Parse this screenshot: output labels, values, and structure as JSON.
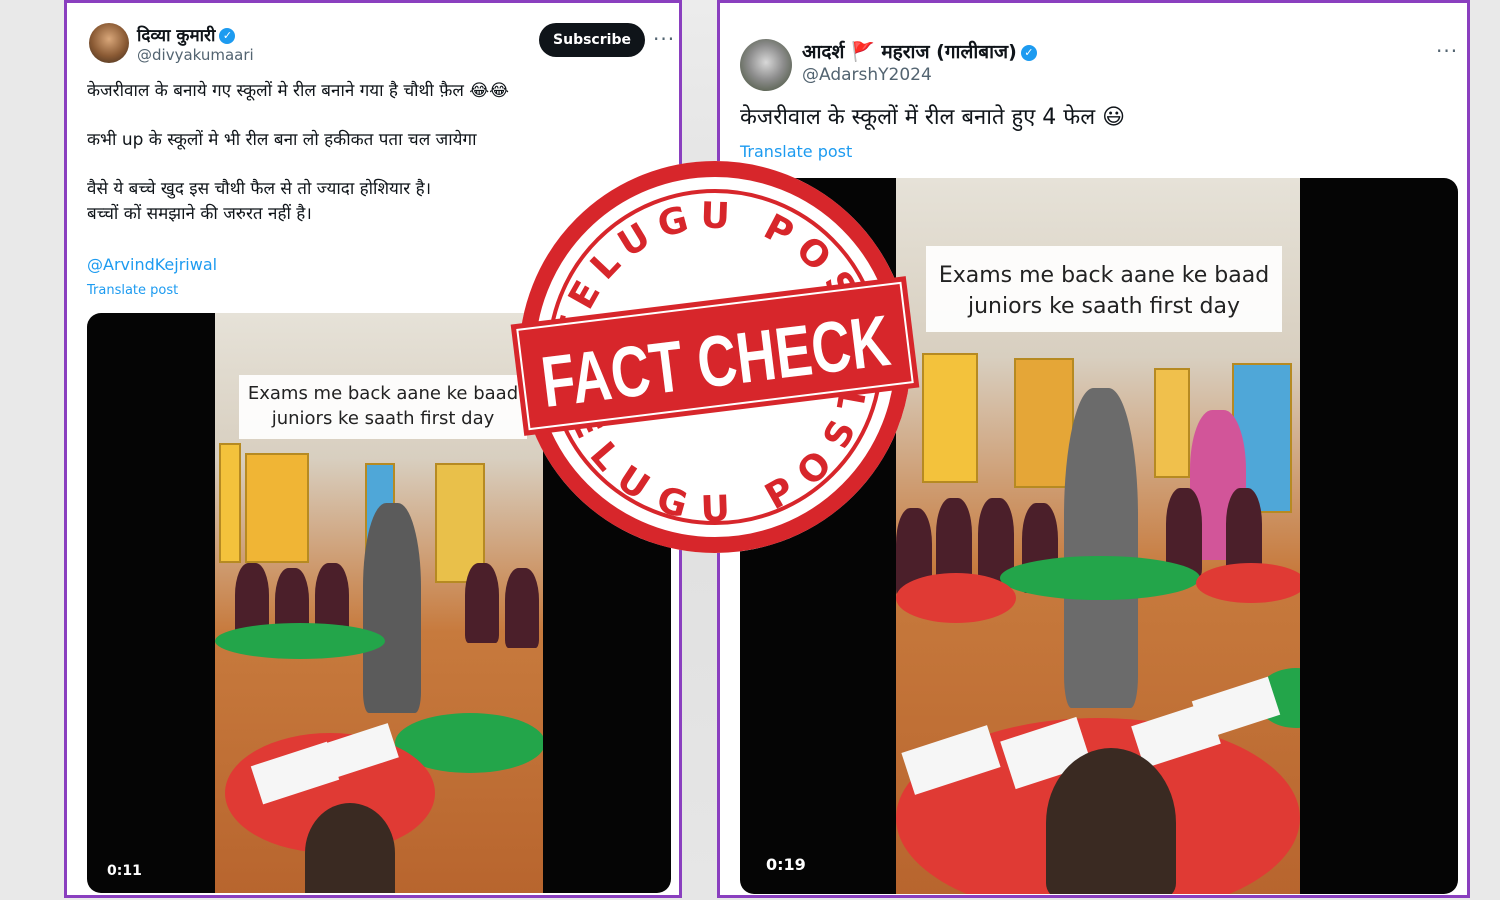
{
  "left_post": {
    "name": "दिव्या कुमारी",
    "handle": "@divyakumaari",
    "subscribe_label": "Subscribe",
    "more_label": "···",
    "text": [
      "केजरीवाल के बनाये गए स्कूलों मे रील बनाने गया है चौथी फ़ैल 😂😂",
      "कभी up के स्कूलों मे भी रील बना लो हकीकत पता चल जायेगा",
      "वैसे ये बच्चे खुद इस चौथी फैल से तो ज्यादा होशियार है।",
      "बच्चों कों समझाने की जरुरत नहीं है।"
    ],
    "mention": "@ArvindKejriwal",
    "translate_label": "Translate post",
    "video": {
      "caption_line1": "Exams me back aane ke baad",
      "caption_line2": "juniors ke saath first day",
      "duration": "0:11"
    }
  },
  "right_post": {
    "name": "आदर्श 🚩 महराज (गालीबाज)",
    "handle": "@AdarshY2024",
    "more_label": "···",
    "text": "केजरीवाल के स्कूलों में रील बनाते हुए 4 फेल 😃",
    "translate_label": "Translate post",
    "video": {
      "caption_line1": "Exams me back aane ke baad",
      "caption_line2": "juniors ke saath first day",
      "duration": "0:19"
    }
  },
  "stamp": {
    "top_arc": "TELUGU POST",
    "center": "FACT CHECK",
    "bottom_arc": "TELUGU POST",
    "color": "#d7262b"
  },
  "colors": {
    "card_border": "#8a3fbf",
    "link": "#1d9bf0",
    "verified": "#1d9bf0"
  }
}
